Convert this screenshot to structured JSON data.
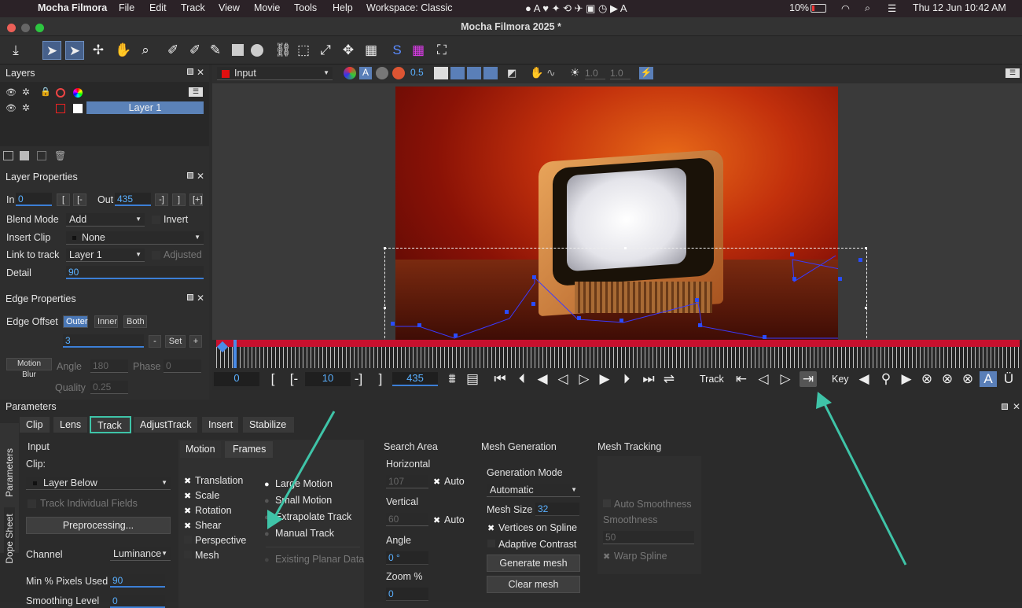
{
  "menubar": {
    "app": "Mocha Filmora",
    "items": [
      "File",
      "Edit",
      "Track",
      "View",
      "Movie",
      "Tools",
      "Help",
      "Workspace: Classic"
    ],
    "battery": "10%",
    "datetime": "Thu 12 Jun  10:42 AM"
  },
  "window": {
    "title": "Mocha Filmora 2025 *"
  },
  "layers": {
    "title": "Layers",
    "layer_name": "Layer 1"
  },
  "layer_properties": {
    "title": "Layer Properties",
    "in_label": "In",
    "in_value": "0",
    "out_label": "Out",
    "out_value": "435",
    "blend_label": "Blend Mode",
    "blend_value": "Add",
    "invert_label": "Invert",
    "insert_label": "Insert Clip",
    "insert_value": "None",
    "link_label": "Link to track",
    "link_value": "Layer 1",
    "adjusted_label": "Adjusted",
    "detail_label": "Detail",
    "detail_value": "90"
  },
  "edge_properties": {
    "title": "Edge Properties",
    "offset_label": "Edge Offset",
    "outer": "Outer",
    "inner": "Inner",
    "both": "Both",
    "offset_value": "3",
    "set": "Set",
    "motion_blur": "Motion Blur",
    "angle_label": "Angle",
    "angle_value": "180",
    "phase_label": "Phase",
    "phase_value": "0",
    "quality_label": "Quality",
    "quality_value": "0.25"
  },
  "viewer": {
    "input_select": "Input",
    "opacity": "0.5",
    "val1": "1.0",
    "val2": "1.0"
  },
  "transport": {
    "frame": "0",
    "in_frame": "10",
    "out_frame": "435",
    "track_label": "Track",
    "key_label": "Key"
  },
  "parameters": {
    "title": "Parameters",
    "tabs": [
      "Clip",
      "Lens",
      "Track",
      "AdjustTrack",
      "Insert",
      "Stabilize"
    ],
    "side_tabs": [
      "Parameters",
      "Dope Sheet"
    ]
  },
  "input": {
    "title": "Input",
    "clip_label": "Clip:",
    "clip_value": "Layer Below",
    "track_fields": "Track Individual Fields",
    "preprocessing": "Preprocessing...",
    "channel_label": "Channel",
    "channel_value": "Luminance",
    "min_pixels_label": "Min % Pixels Used",
    "min_pixels_value": "90",
    "smoothing_label": "Smoothing Level",
    "smoothing_value": "0"
  },
  "motion": {
    "tab_motion": "Motion",
    "tab_frames": "Frames",
    "translation": "Translation",
    "scale": "Scale",
    "rotation": "Rotation",
    "shear": "Shear",
    "perspective": "Perspective",
    "mesh": "Mesh",
    "large_motion": "Large Motion",
    "small_motion": "Small Motion",
    "extrapolate": "Extrapolate Track",
    "manual": "Manual Track",
    "existing": "Existing Planar Data"
  },
  "search_area": {
    "title": "Search Area",
    "horizontal": "Horizontal",
    "h_value": "107",
    "auto": "Auto",
    "vertical": "Vertical",
    "v_value": "60",
    "angle": "Angle",
    "angle_value": "0 °",
    "zoom": "Zoom %",
    "zoom_value": "0"
  },
  "mesh_generation": {
    "title": "Mesh Generation",
    "mode_label": "Generation Mode",
    "mode_value": "Automatic",
    "size_label": "Mesh Size",
    "size_value": "32",
    "vertices": "Vertices on Spline",
    "adaptive": "Adaptive Contrast",
    "generate": "Generate mesh",
    "clear": "Clear mesh"
  },
  "mesh_tracking": {
    "title": "Mesh Tracking",
    "auto_smooth": "Auto Smoothness",
    "smoothness": "Smoothness",
    "smooth_value": "50",
    "warp": "Warp Spline"
  },
  "colors": {
    "accent_teal": "#3fc4a8",
    "accent_blue": "#3c7fd6",
    "timeline_red": "#c8102e"
  }
}
